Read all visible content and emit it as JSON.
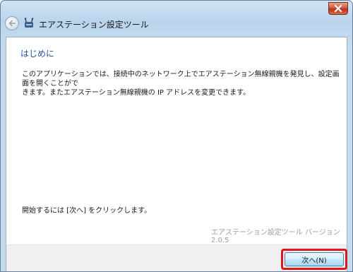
{
  "window": {
    "title": "エアステーション設定ツール"
  },
  "content": {
    "heading": "はじめに",
    "description_line1": "このアプリケーションでは、接続中のネットワーク上でエアステーション無線親機を発見し、設定画面を開くことがで",
    "description_line2": "きます。またエアステーション無線親機の IP アドレスを変更できます。",
    "instruction": "開始するには [次へ] をクリックします。",
    "version": "エアステーション設定ツール バージョン 2.0.5"
  },
  "footer": {
    "next_label": "次へ(N)"
  },
  "icons": {
    "back": "back-arrow-icon",
    "close": "close-icon",
    "app": "router-app-icon"
  },
  "colors": {
    "heading": "#1f4e9e",
    "highlight": "#e0161b",
    "close_button": "#c9452a"
  }
}
